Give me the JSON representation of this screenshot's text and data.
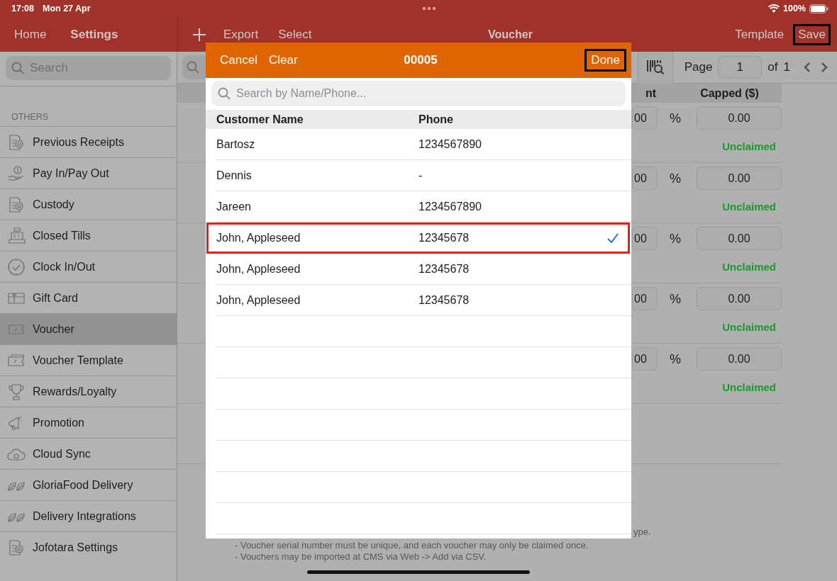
{
  "status_bar": {
    "time": "17:08",
    "date": "Mon 27 Apr",
    "battery": "100%"
  },
  "nav": {
    "home": "Home",
    "title": "Settings"
  },
  "toolbar": {
    "actions": [
      "Export",
      "Select"
    ],
    "title": "Voucher",
    "template": "Template",
    "save": {
      "label": "Save",
      "outlined": true
    }
  },
  "sidebar": {
    "search_placeholder": "Search",
    "section": "OTHERS",
    "items": [
      {
        "label": "Previous Receipts",
        "selected": false
      },
      {
        "label": "Pay In/Pay Out",
        "selected": false
      },
      {
        "label": "Custody",
        "selected": false
      },
      {
        "label": "Closed Tills",
        "selected": false
      },
      {
        "label": "Clock In/Out",
        "selected": false
      },
      {
        "label": "Gift Card",
        "selected": false
      },
      {
        "label": "Voucher",
        "selected": true
      },
      {
        "label": "Voucher Template",
        "selected": false
      },
      {
        "label": "Rewards/Loyalty",
        "selected": false
      },
      {
        "label": "Promotion",
        "selected": false
      },
      {
        "label": "Cloud Sync",
        "selected": false
      },
      {
        "label": "GloriaFood Delivery",
        "selected": false
      },
      {
        "label": "Delivery Integrations",
        "selected": false
      },
      {
        "label": "Jofotara Settings",
        "selected": false
      }
    ]
  },
  "pager": {
    "label": "Page",
    "page": "1",
    "of": "of",
    "total": "1"
  },
  "table": {
    "columns": [
      "nt",
      "Capped ($)"
    ],
    "rows": [
      {
        "amount": "00",
        "unit": "%",
        "capped": "0.00",
        "status": "Unclaimed"
      },
      {
        "amount": "00",
        "unit": "%",
        "capped": "0.00",
        "status": "Unclaimed"
      },
      {
        "amount": "00",
        "unit": "%",
        "capped": "0.00",
        "status": "Unclaimed"
      },
      {
        "amount": "00",
        "unit": "%",
        "capped": "0.00",
        "status": "Unclaimed"
      },
      {
        "amount": "00",
        "unit": "%",
        "capped": "0.00",
        "status": "Unclaimed"
      }
    ]
  },
  "notes": [
    "ype.",
    "- Voucher serial number must be unique, and each voucher may only be claimed once.",
    "- Vouchers may be imported at CMS via Web -> Add via CSV."
  ],
  "modal": {
    "cancel": "Cancel",
    "clear": "Clear",
    "title": "00005",
    "done": {
      "label": "Done",
      "outlined": true
    },
    "search_placeholder": "Search by Name/Phone...",
    "columns": [
      "Customer Name",
      "Phone"
    ],
    "rows": [
      {
        "name": "Bartosz",
        "phone": "1234567890",
        "selected": false
      },
      {
        "name": "Dennis",
        "phone": "-",
        "selected": false
      },
      {
        "name": "Jareen",
        "phone": "1234567890",
        "selected": false
      },
      {
        "name": "John, Appleseed",
        "phone": "12345678",
        "selected": true
      },
      {
        "name": "John, Appleseed",
        "phone": "12345678",
        "selected": false
      },
      {
        "name": "John, Appleseed",
        "phone": "12345678",
        "selected": false
      }
    ]
  }
}
